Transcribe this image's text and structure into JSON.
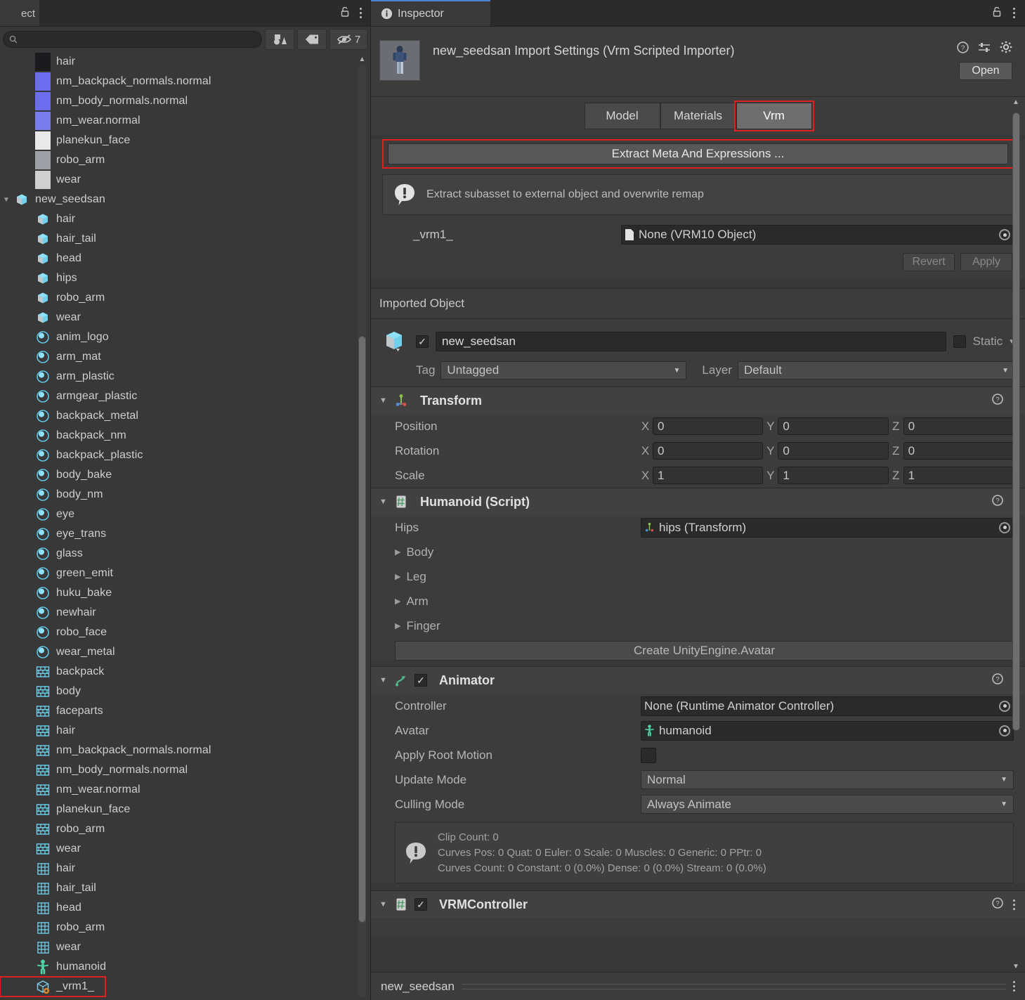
{
  "project": {
    "tab_label": "ect",
    "search_placeholder": "",
    "hidden_count": "7",
    "icons": {
      "search": "search-icon",
      "filter_by_type": "filter-by-type-icon",
      "filter_by_label": "filter-by-label-icon",
      "visibility_toggle": "eye-slash-icon",
      "lock": "lock-icon",
      "kebab": "more-menu-icon"
    },
    "items": [
      {
        "label": "hair",
        "type": "texture",
        "indent": 2,
        "swatch": "#1b1b1f"
      },
      {
        "label": "nm_backpack_normals.normal",
        "type": "texture",
        "indent": 2,
        "swatch": "#6d6df2"
      },
      {
        "label": "nm_body_normals.normal",
        "type": "texture",
        "indent": 2,
        "swatch": "#6d6df2"
      },
      {
        "label": "nm_wear.normal",
        "type": "texture",
        "indent": 2,
        "swatch": "#7b7bf0"
      },
      {
        "label": "planekun_face",
        "type": "texture",
        "indent": 2,
        "swatch": "#e9e9e9"
      },
      {
        "label": "robo_arm",
        "type": "texture",
        "indent": 2,
        "swatch": "#9aa0a6"
      },
      {
        "label": "wear",
        "type": "texture",
        "indent": 2,
        "swatch": "#cfcfcf"
      },
      {
        "label": "new_seedsan",
        "type": "model",
        "indent": 1,
        "expanded": true
      },
      {
        "label": "hair",
        "type": "mesh",
        "indent": 2
      },
      {
        "label": "hair_tail",
        "type": "mesh",
        "indent": 2
      },
      {
        "label": "head",
        "type": "mesh",
        "indent": 2
      },
      {
        "label": "hips",
        "type": "mesh",
        "indent": 2
      },
      {
        "label": "robo_arm",
        "type": "mesh",
        "indent": 2
      },
      {
        "label": "wear",
        "type": "mesh",
        "indent": 2
      },
      {
        "label": "anim_logo",
        "type": "material",
        "indent": 2
      },
      {
        "label": "arm_mat",
        "type": "material",
        "indent": 2
      },
      {
        "label": "arm_plastic",
        "type": "material",
        "indent": 2
      },
      {
        "label": "armgear_plastic",
        "type": "material",
        "indent": 2
      },
      {
        "label": "backpack_metal",
        "type": "material",
        "indent": 2
      },
      {
        "label": "backpack_nm",
        "type": "material",
        "indent": 2
      },
      {
        "label": "backpack_plastic",
        "type": "material",
        "indent": 2
      },
      {
        "label": "body_bake",
        "type": "material",
        "indent": 2
      },
      {
        "label": "body_nm",
        "type": "material",
        "indent": 2
      },
      {
        "label": "eye",
        "type": "material",
        "indent": 2
      },
      {
        "label": "eye_trans",
        "type": "material",
        "indent": 2
      },
      {
        "label": "glass",
        "type": "material",
        "indent": 2
      },
      {
        "label": "green_emit",
        "type": "material",
        "indent": 2
      },
      {
        "label": "huku_bake",
        "type": "material",
        "indent": 2
      },
      {
        "label": "newhair",
        "type": "material",
        "indent": 2
      },
      {
        "label": "robo_face",
        "type": "material",
        "indent": 2
      },
      {
        "label": "wear_metal",
        "type": "material",
        "indent": 2
      },
      {
        "label": "backpack",
        "type": "texture2d",
        "indent": 2
      },
      {
        "label": "body",
        "type": "texture2d",
        "indent": 2
      },
      {
        "label": "faceparts",
        "type": "texture2d",
        "indent": 2
      },
      {
        "label": "hair",
        "type": "texture2d",
        "indent": 2
      },
      {
        "label": "nm_backpack_normals.normal",
        "type": "texture2d",
        "indent": 2
      },
      {
        "label": "nm_body_normals.normal",
        "type": "texture2d",
        "indent": 2
      },
      {
        "label": "nm_wear.normal",
        "type": "texture2d",
        "indent": 2
      },
      {
        "label": "planekun_face",
        "type": "texture2d",
        "indent": 2
      },
      {
        "label": "robo_arm",
        "type": "texture2d",
        "indent": 2
      },
      {
        "label": "wear",
        "type": "texture2d",
        "indent": 2
      },
      {
        "label": "hair",
        "type": "grid",
        "indent": 2
      },
      {
        "label": "hair_tail",
        "type": "grid",
        "indent": 2
      },
      {
        "label": "head",
        "type": "grid",
        "indent": 2
      },
      {
        "label": "robo_arm",
        "type": "grid",
        "indent": 2
      },
      {
        "label": "wear",
        "type": "grid",
        "indent": 2
      },
      {
        "label": "humanoid",
        "type": "avatar",
        "indent": 2
      },
      {
        "label": "_vrm1_",
        "type": "vrm",
        "indent": 2,
        "highlighted": true
      }
    ]
  },
  "inspector": {
    "tab_label": "Inspector",
    "importer": {
      "title": "new_seedsan Import Settings (Vrm Scripted Importer)",
      "open_label": "Open",
      "tabs": [
        {
          "label": "Model",
          "active": false
        },
        {
          "label": "Materials",
          "active": false
        },
        {
          "label": "Vrm",
          "active": true,
          "highlighted": true
        }
      ],
      "extract_button": "Extract Meta And Expressions ...",
      "help_text": "Extract subasset to external object and overwrite remap",
      "remap": {
        "label": "_vrm1_",
        "value": "None (VRM10 Object)"
      },
      "revert_label": "Revert",
      "apply_label": "Apply"
    },
    "imported_object": {
      "header": "Imported Object",
      "name": "new_seedsan",
      "static_label": "Static",
      "tag_label": "Tag",
      "tag_value": "Untagged",
      "layer_label": "Layer",
      "layer_value": "Default"
    },
    "components": [
      {
        "name": "Transform",
        "icon": "transform-icon",
        "rows": [
          {
            "label": "Position",
            "x": "0",
            "y": "0",
            "z": "0"
          },
          {
            "label": "Rotation",
            "x": "0",
            "y": "0",
            "z": "0"
          },
          {
            "label": "Scale",
            "x": "1",
            "y": "1",
            "z": "1"
          }
        ]
      },
      {
        "name": "Humanoid (Script)",
        "icon": "script-icon",
        "hips_label": "Hips",
        "hips_value": "hips (Transform)",
        "folds": [
          "Body",
          "Leg",
          "Arm",
          "Finger"
        ],
        "create_button": "Create UnityEngine.Avatar"
      },
      {
        "name": "Animator",
        "icon": "animator-icon",
        "rows": [
          {
            "label": "Controller",
            "value": "None (Runtime Animator Controller)",
            "kind": "object"
          },
          {
            "label": "Avatar",
            "value": "humanoid",
            "kind": "object-avatar"
          },
          {
            "label": "Apply Root Motion",
            "value": "",
            "kind": "checkbox"
          },
          {
            "label": "Update Mode",
            "value": "Normal",
            "kind": "dropdown"
          },
          {
            "label": "Culling Mode",
            "value": "Always Animate",
            "kind": "dropdown"
          }
        ],
        "info": [
          "Clip Count: 0",
          "Curves Pos: 0 Quat: 0 Euler: 0 Scale: 0 Muscles: 0 Generic: 0 PPtr: 0",
          "Curves Count: 0 Constant: 0 (0.0%) Dense: 0 (0.0%) Stream: 0 (0.0%)"
        ]
      },
      {
        "name": "VRMController",
        "icon": "script-icon"
      }
    ],
    "statusbar": {
      "name": "new_seedsan"
    }
  },
  "colors": {
    "accent_tab": "#4b86d4",
    "highlight_red": "#e02020",
    "panel_bg": "#383838",
    "header_bg": "#3c3c3c",
    "mesh_blue": "#7fd4ef",
    "avatar_green": "#4fd6a6"
  }
}
